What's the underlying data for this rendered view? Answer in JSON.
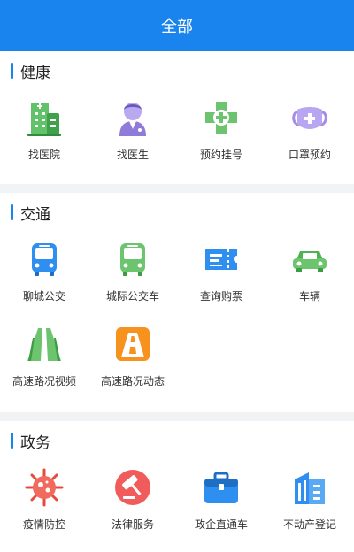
{
  "header": {
    "title": "全部"
  },
  "health": {
    "title": "健康",
    "items": [
      {
        "label": "找医院",
        "icon": "hospital-building-icon"
      },
      {
        "label": "找医生",
        "icon": "doctor-icon"
      },
      {
        "label": "预约挂号",
        "icon": "medical-cross-icon"
      },
      {
        "label": "口罩预约",
        "icon": "face-mask-icon"
      }
    ]
  },
  "traffic": {
    "title": "交通",
    "items": [
      {
        "label": "聊城公交",
        "icon": "bus-icon"
      },
      {
        "label": "城际公交车",
        "icon": "intercity-bus-icon"
      },
      {
        "label": "查询购票",
        "icon": "ticket-icon"
      },
      {
        "label": "车辆",
        "icon": "car-icon"
      },
      {
        "label": "高速路况视频",
        "icon": "highway-video-icon"
      },
      {
        "label": "高速路况动态",
        "icon": "highway-status-icon"
      }
    ]
  },
  "gov": {
    "title": "政务",
    "items": [
      {
        "label": "疫情防控",
        "icon": "virus-icon"
      },
      {
        "label": "法律服务",
        "icon": "gavel-icon"
      },
      {
        "label": "政企直通车",
        "icon": "briefcase-icon"
      },
      {
        "label": "不动产登记",
        "icon": "buildings-icon"
      }
    ]
  }
}
